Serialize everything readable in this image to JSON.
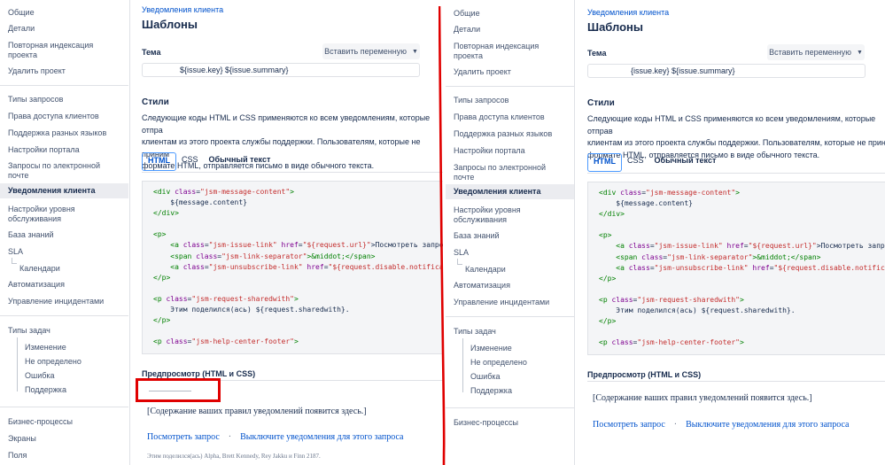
{
  "sidebar": {
    "items": [
      {
        "label": "Общие"
      },
      {
        "label": "Детали"
      },
      {
        "label": "Повторная индексация проекта"
      },
      {
        "label": "Удалить проект"
      },
      {
        "label": "Типы запросов"
      },
      {
        "label": "Права доступа клиентов"
      },
      {
        "label": "Поддержка разных языков"
      },
      {
        "label": "Настройки портала"
      },
      {
        "label": "Запросы по электронной почте"
      },
      {
        "label": "Уведомления клиента"
      },
      {
        "label": "Настройки уровня обслуживания"
      },
      {
        "label": "База знаний"
      },
      {
        "label": "SLA"
      },
      {
        "label": "Календари"
      },
      {
        "label": "Автоматизация"
      },
      {
        "label": "Управление инцидентами"
      },
      {
        "label": "Типы задач"
      },
      {
        "label": "Изменение"
      },
      {
        "label": "Не определено"
      },
      {
        "label": "Ошибка"
      },
      {
        "label": "Поддержка"
      },
      {
        "label": "Бизнес-процессы"
      },
      {
        "label": "Экраны"
      },
      {
        "label": "Поля"
      }
    ]
  },
  "main": {
    "breadcrumb": "Уведомления клиента",
    "title": "Шаблоны",
    "theme_label": "Тема",
    "insert_variable": "Вставить переменную",
    "theme_value": "${issue.key} ${issue.summary}",
    "theme_value_right": "{issue.key} ${issue.summary}",
    "styles_heading": "Стили",
    "description_left": "Следующие коды HTML и CSS применяются ко всем уведомлениям, которые отпра\nклиентам из этого проекта службы поддержки. Пользователям, которые не приним\nформате HTML, отправляется письмо в виде обычного текста.",
    "description_right": "Следующие коды HTML и CSS применяются ко всем уведомлениям, которые отправ\nклиентам из этого проекта службы поддержки. Пользователям, которые не прини\nформате HTML, отправляется письмо в виде обычного текста.",
    "tabs": [
      {
        "label": "HTML"
      },
      {
        "label": "CSS"
      },
      {
        "label": "Обычный текст"
      }
    ],
    "code": {
      "l1_tag": "<div ",
      "l1_attr": "class",
      "l1_val": "\"jsm-message-content\"",
      "l1_end": ">",
      "l2": "    ${message.content}",
      "l3": "</div>",
      "l5": "<p>",
      "l6_tag": "    <a ",
      "l6_attr": "class",
      "l6_val": "\"jsm-issue-link\"",
      "l6_attr2": " href",
      "l6_val2": "\"${request.url}\"",
      "l6_end": ">Посмотреть запрос",
      "l7_tag": "    <span ",
      "l7_attr": "class",
      "l7_val": "\"jsm-link-separator\"",
      "l7_end": ">&middot;</span>",
      "l8_tag": "    <a ",
      "l8_attr": "class",
      "l8_val": "\"jsm-unsubscribe-link\"",
      "l8_attr2": " href",
      "l8_val2": "\"${request.disable.notifica",
      "l9": "</p>",
      "l11_tag": "<p ",
      "l11_attr": "class",
      "l11_val": "\"jsm-request-sharedwith\"",
      "l11_end": ">",
      "l12": "    Этим поделился(ась) ${request.sharedwith}.",
      "l13": "</p>",
      "l15_tag": "<p ",
      "l15_attr": "class",
      "l15_val": "\"jsm-help-center-footer\"",
      "l15_end": ">"
    },
    "preview_label": "Предпросмотр (HTML и CSS)",
    "preview_text": "[Содержание ваших правил уведомлений появится здесь.]",
    "preview_link_view": "Посмотреть запрос",
    "preview_dot": "·",
    "preview_link_unsub": "Выключите уведомления для этого запроса",
    "preview_footer": "Этим поделился(ась) Alpha, Brett Kennedy, Rey Jakku и Finn 2187."
  },
  "colors": {
    "highlight_box": "#e00000",
    "link": "#0052cc",
    "active_nav_bg": "#ebecf0"
  }
}
